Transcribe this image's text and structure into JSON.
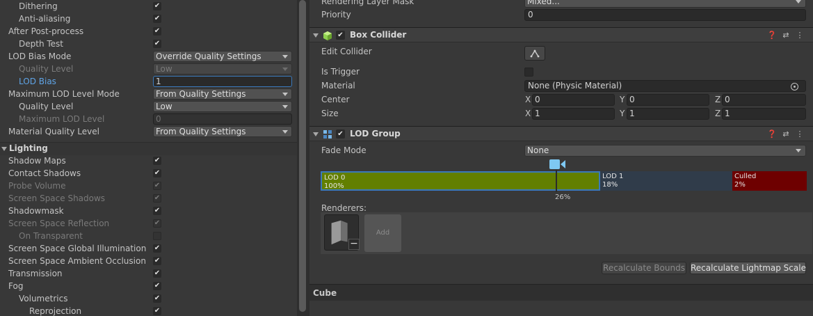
{
  "left_panel": {
    "rows": [
      {
        "label": "Dithering",
        "indent": 1,
        "control": "check",
        "value": true
      },
      {
        "label": "Anti-aliasing",
        "indent": 1,
        "control": "check",
        "value": true
      },
      {
        "label": "After Post-process",
        "indent": 0,
        "control": "check",
        "value": true
      },
      {
        "label": "Depth Test",
        "indent": 1,
        "control": "check",
        "value": true
      },
      {
        "label": "LOD Bias Mode",
        "indent": 0,
        "control": "dropdown",
        "value": "Override Quality Settings"
      },
      {
        "label": "Quality Level",
        "indent": 1,
        "control": "dropdown",
        "value": "Low",
        "disabled": true
      },
      {
        "label": "LOD Bias",
        "indent": 1,
        "control": "text",
        "value": "1",
        "focused": true
      },
      {
        "label": "Maximum LOD Level Mode",
        "indent": 0,
        "control": "dropdown",
        "value": "From Quality Settings"
      },
      {
        "label": "Quality Level",
        "indent": 1,
        "control": "dropdown",
        "value": "Low"
      },
      {
        "label": "Maximum LOD Level",
        "indent": 1,
        "control": "text",
        "value": "0",
        "disabled": true
      },
      {
        "label": "Material Quality Level",
        "indent": 0,
        "control": "dropdown",
        "value": "From Quality Settings"
      }
    ],
    "section_label": "Lighting",
    "lighting_rows": [
      {
        "label": "Shadow Maps",
        "indent": 0,
        "control": "check",
        "value": true
      },
      {
        "label": "Contact Shadows",
        "indent": 0,
        "control": "check",
        "value": true
      },
      {
        "label": "Probe Volume",
        "indent": 0,
        "control": "check",
        "value": true,
        "disabled": true
      },
      {
        "label": "Screen Space Shadows",
        "indent": 0,
        "control": "check",
        "value": true,
        "disabled": true
      },
      {
        "label": "Shadowmask",
        "indent": 0,
        "control": "check",
        "value": true
      },
      {
        "label": "Screen Space Reflection",
        "indent": 0,
        "control": "check",
        "value": true,
        "disabled": true
      },
      {
        "label": "On Transparent",
        "indent": 1,
        "control": "check",
        "value": false,
        "disabled": true
      },
      {
        "label": "Screen Space Global Illumination",
        "indent": 0,
        "control": "check",
        "value": true
      },
      {
        "label": "Screen Space Ambient Occlusion",
        "indent": 0,
        "control": "check",
        "value": true
      },
      {
        "label": "Transmission",
        "indent": 0,
        "control": "check",
        "value": true
      },
      {
        "label": "Fog",
        "indent": 0,
        "control": "check",
        "value": true
      },
      {
        "label": "Volumetrics",
        "indent": 1,
        "control": "check",
        "value": true
      },
      {
        "label": "Reprojection",
        "indent": 2,
        "control": "check",
        "value": true
      }
    ]
  },
  "right_panel": {
    "rendering_layer_mask": {
      "label": "Rendering Layer Mask",
      "value": "Mixed..."
    },
    "priority": {
      "label": "Priority",
      "value": "0"
    },
    "box_collider": {
      "title": "Box Collider",
      "edit_collider_label": "Edit Collider",
      "is_trigger_label": "Is Trigger",
      "material_label": "Material",
      "material_value": "None (Physic Material)",
      "center_label": "Center",
      "center": {
        "x": "0",
        "y": "0",
        "z": "0"
      },
      "size_label": "Size",
      "size": {
        "x": "1",
        "y": "1",
        "z": "1"
      }
    },
    "axis_labels": {
      "x": "X",
      "y": "Y",
      "z": "Z"
    },
    "lod_group": {
      "title": "LOD Group",
      "fade_mode_label": "Fade Mode",
      "fade_mode_value": "None",
      "segments": [
        {
          "name": "LOD 0",
          "percent": "100%",
          "color": "#627f00"
        },
        {
          "name": "LOD 1",
          "percent": "18%",
          "color": "#303c4a"
        },
        {
          "name": "Culled",
          "percent": "2%",
          "color": "#6e0000"
        }
      ],
      "camera_percent": "26%",
      "renderers_label": "Renderers:",
      "add_label": "Add",
      "minus_label": "−"
    },
    "buttons": {
      "recalc_bounds": "Recalculate Bounds",
      "recalc_lightmap": "Recalculate Lightmap Scale"
    },
    "footer_object": "Cube"
  },
  "colors": {
    "accent": "#3a79bb",
    "lod_camera": "#7ec8f2",
    "box_collider_icon": "#8fd14f"
  }
}
